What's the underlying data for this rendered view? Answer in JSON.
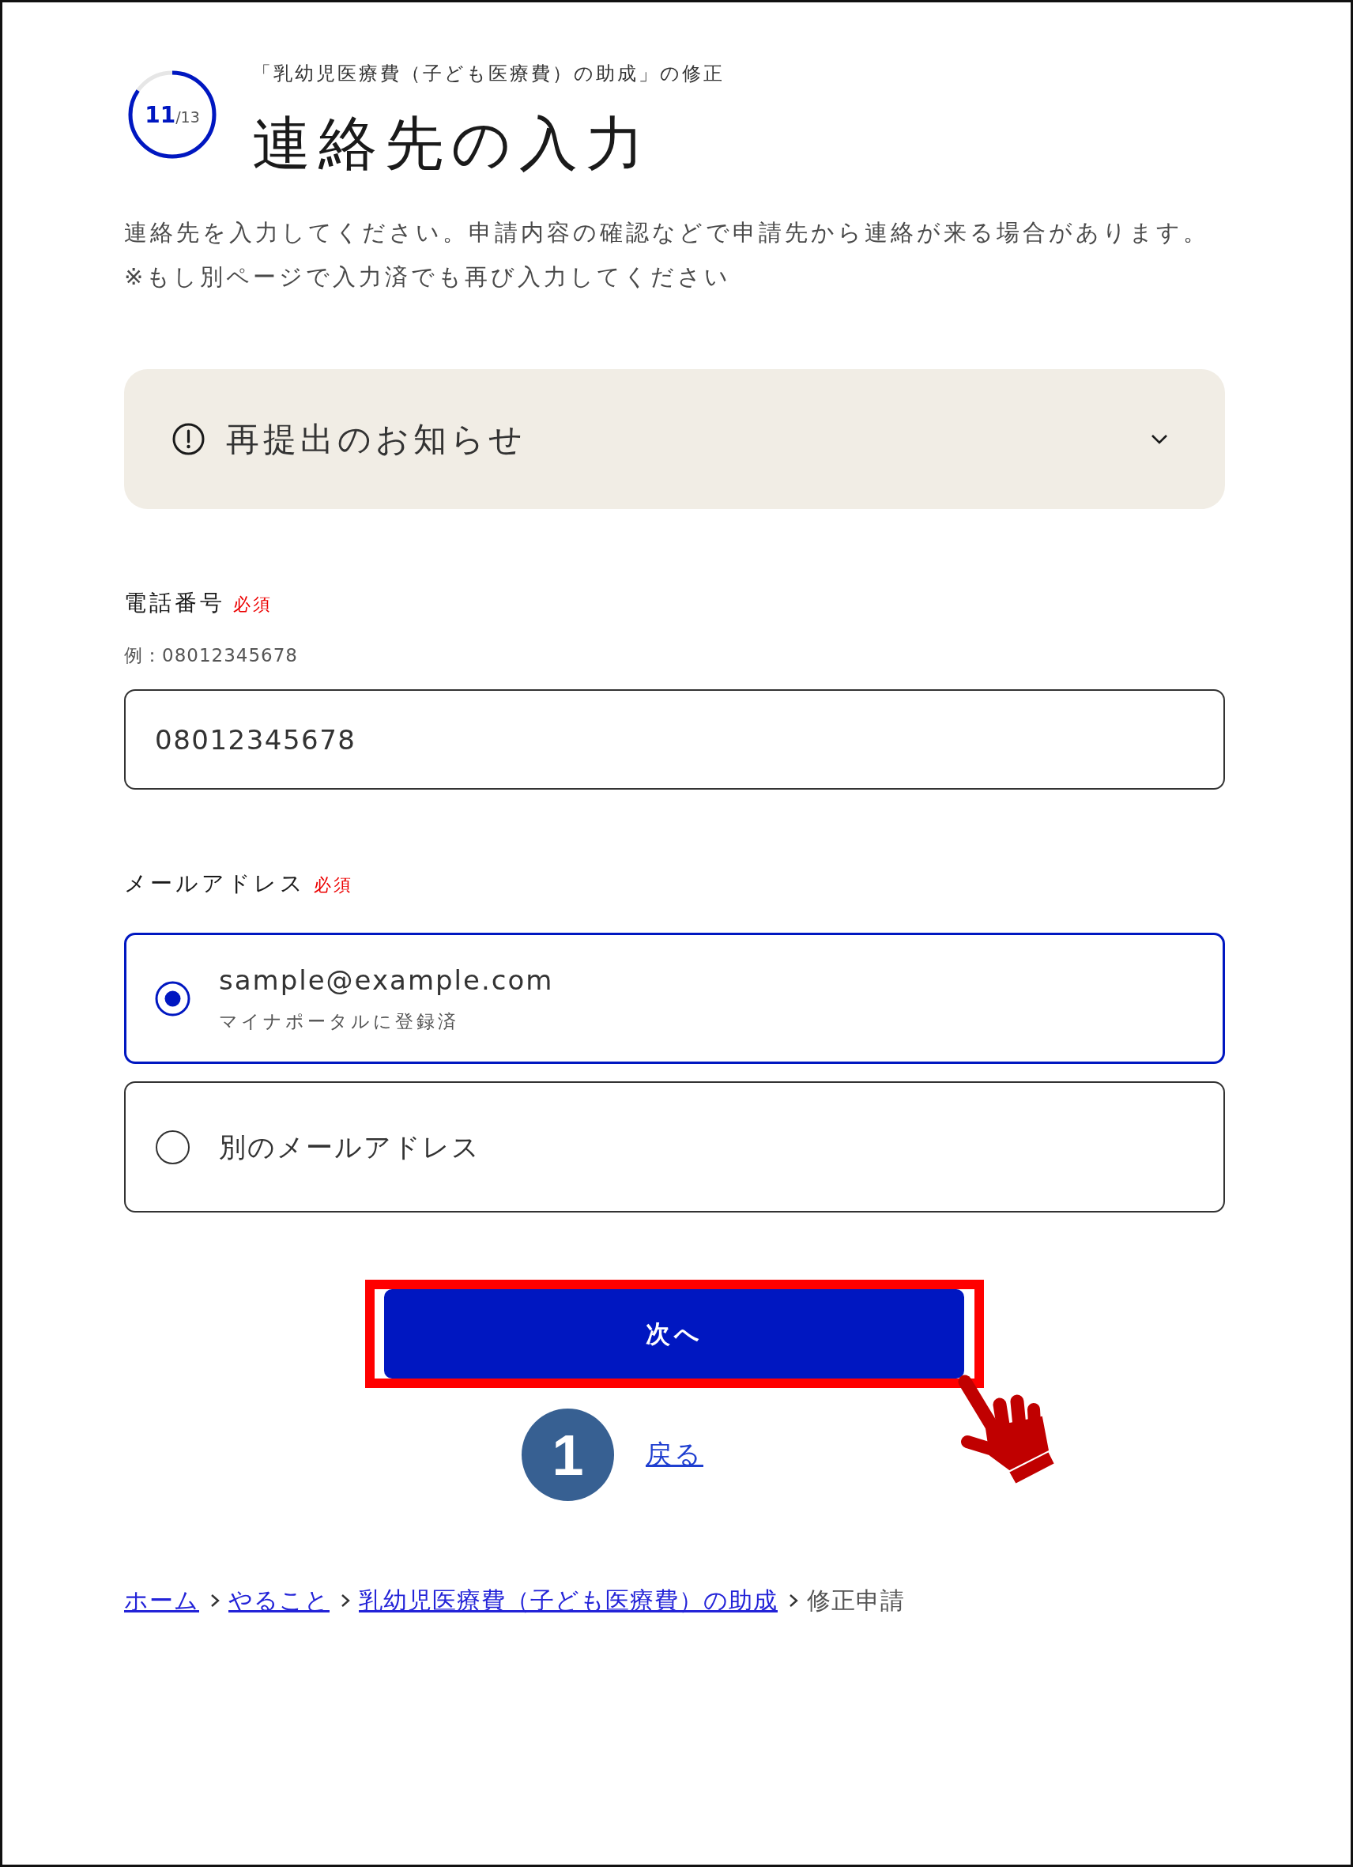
{
  "header": {
    "progress": {
      "count": "**11**/13",
      "level": 0.846
    },
    "subtitle": "「乳幼児医療費（子ども医療費）の助成」の修正",
    "title": "連絡先の入力"
  },
  "description": [
    "連絡先を入力してください。申請内容の確認などで申請先から連絡が来る場合があります。",
    "※もし別ページで入力済でも再び入力してください"
  ],
  "notice": {
    "title": "再提出のお知らせ",
    "expanded": false
  },
  "phone": {
    "label": "電話番号",
    "required": "必須",
    "example": "例：08012345678",
    "value": "08012345678"
  },
  "email": {
    "label": "メールアドレス",
    "required": "必須",
    "options": [
      {
        "label": "sample@example.com",
        "note": "マイナポータルに登録済",
        "selected": true
      },
      {
        "label": "別のメールアドレス",
        "selected": false
      }
    ]
  },
  "actions": {
    "next": "次へ",
    "back": "戻る"
  },
  "annotation": {
    "step": "1"
  },
  "breadcrumb": [
    {
      "label": "ホーム",
      "kind": "link"
    },
    {
      "label": "やること",
      "kind": "link"
    },
    {
      "label": "乳幼児医療費（子ども医療費）の助成",
      "kind": "link"
    },
    {
      "label": "修正申請",
      "kind": "current"
    }
  ]
}
